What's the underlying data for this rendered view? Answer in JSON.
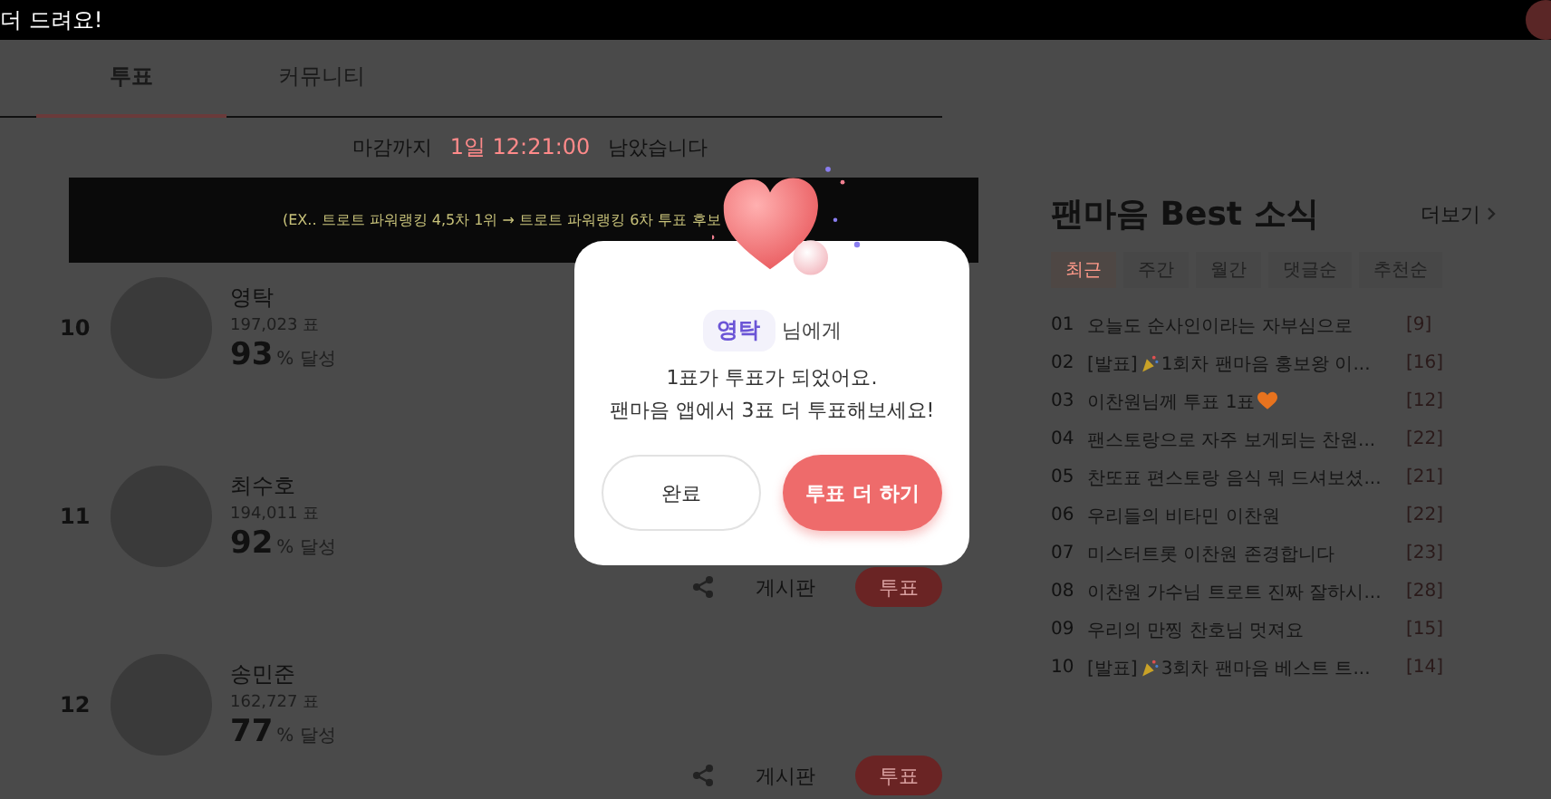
{
  "top_bar": {
    "text": "더 드려요!"
  },
  "tabs": [
    {
      "label": "투표",
      "selected": true
    },
    {
      "label": "커뮤니티",
      "selected": false
    }
  ],
  "deadline": {
    "prefix": "마감까지",
    "time": "1일 12:21:00",
    "suffix": "남았습니다"
  },
  "notice_banner": {
    "text": "(EX.. 트로트 파워랭킹 4,5차 1위 → 트로트 파워랭킹 6차 투표 후보"
  },
  "candidates": [
    {
      "rank": "10",
      "name": "영탁",
      "votes": "197,023 표",
      "percent": "93",
      "percent_suffix": "% 달성"
    },
    {
      "rank": "11",
      "name": "최수호",
      "votes": "194,011 표",
      "percent": "92",
      "percent_suffix": "% 달성",
      "actions": {
        "board_label": "게시판",
        "vote_label": "투표"
      }
    },
    {
      "rank": "12",
      "name": "송민준",
      "votes": "162,727 표",
      "percent": "77",
      "percent_suffix": "% 달성",
      "actions": {
        "board_label": "게시판",
        "vote_label": "투표"
      }
    }
  ],
  "news": {
    "title": "팬마음 Best 소식",
    "more": "더보기",
    "filters": [
      {
        "label": "최근",
        "selected": true
      },
      {
        "label": "주간",
        "selected": false
      },
      {
        "label": "월간",
        "selected": false
      },
      {
        "label": "댓글순",
        "selected": false
      },
      {
        "label": "추천순",
        "selected": false
      }
    ],
    "items": [
      {
        "no": "01",
        "title": "오늘도 순사인이라는 자부심으로",
        "comments": "[9]"
      },
      {
        "no": "02",
        "title": "[발표]",
        "kind": "party",
        "after": "1회차 팬마음 홍보왕 이...",
        "comments": "[16]"
      },
      {
        "no": "03",
        "title": "이찬원님께 투표 1표",
        "kind": "heart",
        "comments": "[12]"
      },
      {
        "no": "04",
        "title": "팬스토랑으로 자주 보게되는 찬원...",
        "comments": "[22]"
      },
      {
        "no": "05",
        "title": "찬또표 편스토랑 음식 뭐 드셔보셨...",
        "comments": "[21]"
      },
      {
        "no": "06",
        "title": "우리들의 비타민 이찬원",
        "comments": "[22]"
      },
      {
        "no": "07",
        "title": "미스터트롯 이찬원 존경합니다",
        "comments": "[23]"
      },
      {
        "no": "08",
        "title": "이찬원 가수님 트로트 진짜 잘하시...",
        "comments": "[28]"
      },
      {
        "no": "09",
        "title": "우리의 만찡 찬호님 멋져요",
        "comments": "[15]"
      },
      {
        "no": "10",
        "title": "[발표]",
        "kind": "party",
        "after": "3회차 팬마음 베스트 트...",
        "comments": "[14]"
      }
    ]
  },
  "modal": {
    "recipient": "영탁",
    "recipient_suffix": "님에게",
    "lines": [
      "1표가 투표가 되었어요.",
      "팬마음 앱에서 3표 더 투표해보세요!"
    ],
    "buttons": [
      {
        "label": "완료",
        "kind": "secondary"
      },
      {
        "label": "투표 더 하기",
        "kind": "primary"
      }
    ]
  }
}
